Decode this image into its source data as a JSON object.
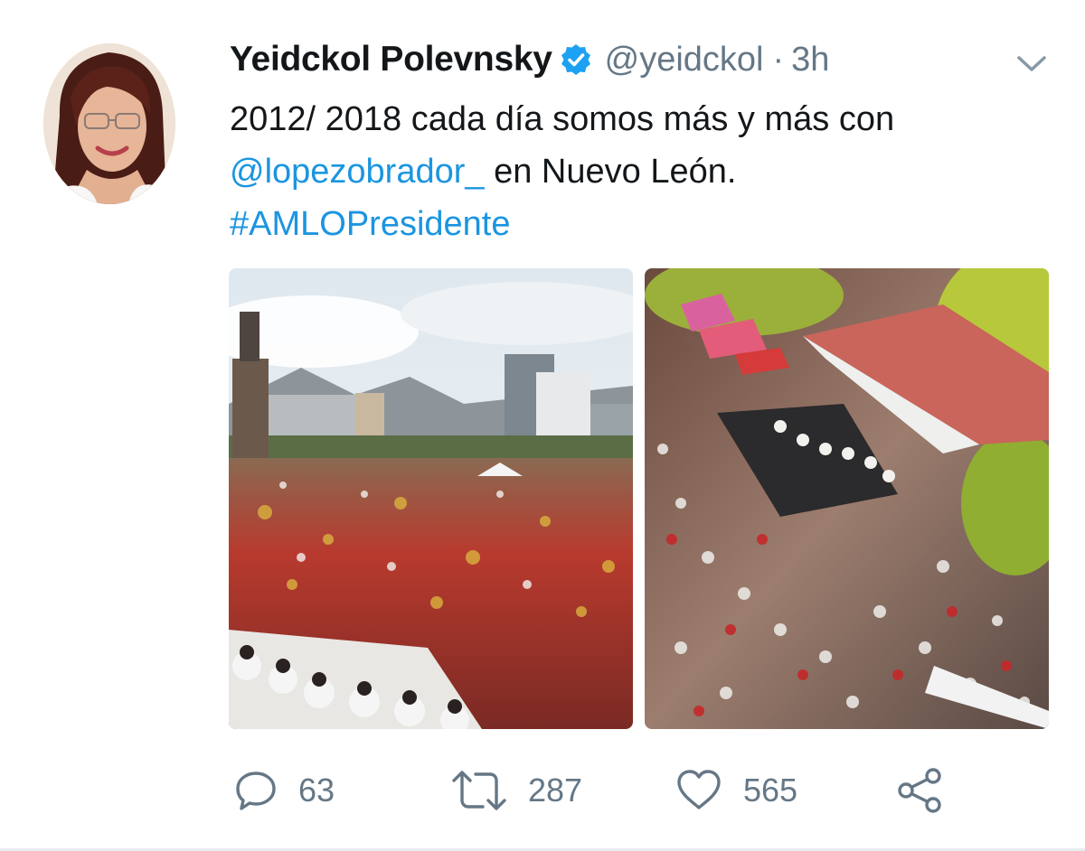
{
  "author": {
    "display_name": "Yeidckol Polevnsky",
    "handle": "@yeidckol",
    "separator": "·",
    "timestamp": "3h"
  },
  "tweet": {
    "text_part1": "2012/ 2018 cada día somos más y más con",
    "mention": "@lopezobrador_",
    "text_part2": " en Nuevo León.",
    "hashtag": "#AMLOPresidente"
  },
  "actions": {
    "replies": "63",
    "retweets": "287",
    "likes": "565"
  },
  "icons": {
    "reply": "reply-icon",
    "retweet": "retweet-icon",
    "like": "heart-icon",
    "share": "share-icon",
    "verified": "verified-badge-icon",
    "menu": "chevron-down-icon"
  },
  "colors": {
    "link": "#1b95e0",
    "verified": "#1da1f2",
    "secondary_text": "#657786",
    "primary_text": "#14171a"
  }
}
